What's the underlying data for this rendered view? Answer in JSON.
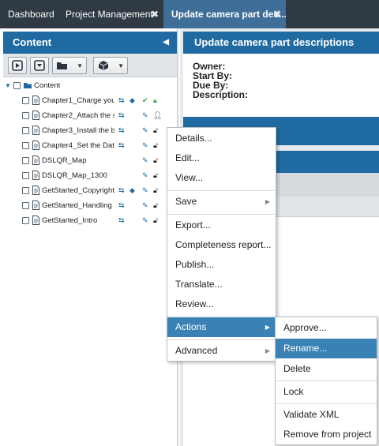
{
  "tabs": [
    {
      "label": "Dashboard"
    },
    {
      "label": "Project Management"
    },
    {
      "label": "Update camera part des..."
    }
  ],
  "left_panel": {
    "title": "Content",
    "toolbar": [
      {
        "icon": "play-icon"
      },
      {
        "icon": "download-icon"
      },
      {
        "icon": "folder-open-icon"
      },
      {
        "icon": "package-icon"
      }
    ],
    "root": {
      "label": "Content"
    },
    "items": [
      {
        "label": "Chapter1_Charge you...",
        "icons": [
          "sync-icon",
          "tags-icon",
          "check-circle-icon",
          "lock-icon"
        ]
      },
      {
        "label": "Chapter2_Attach the s...",
        "icons": [
          "sync-icon",
          "pencil-icon",
          "user-icon"
        ]
      },
      {
        "label": "Chapter3_Install the b...",
        "icons": [
          "sync-icon",
          "pencil-icon",
          "unlock-icon"
        ]
      },
      {
        "label": "Chapter4_Set the Dat...",
        "icons": [
          "sync-icon",
          "pencil-icon",
          "unlock-icon"
        ]
      },
      {
        "label": "DSLQR_Map",
        "icons": [
          "pencil-icon",
          "unlock-icon"
        ]
      },
      {
        "label": "DSLQR_Map_1300",
        "icons": [
          "pencil-icon",
          "unlock-icon"
        ]
      },
      {
        "label": "GetStarted_Copyrights",
        "icons": [
          "sync-icon",
          "tags-icon",
          "pencil-icon",
          "unlock-icon"
        ]
      },
      {
        "label": "GetStarted_Handling ...",
        "icons": [
          "sync-icon",
          "pencil-icon",
          "unlock-icon"
        ]
      },
      {
        "label": "GetStarted_Intro",
        "icons": [
          "sync-icon",
          "pencil-icon",
          "unlock-icon"
        ]
      }
    ]
  },
  "right_panel": {
    "title": "Update camera part descriptions",
    "fields": {
      "owner": "Owner:",
      "start_by": "Start By:",
      "due_by": "Due By:",
      "description": "Description:"
    }
  },
  "context_menu": {
    "items": [
      {
        "label": "Details..."
      },
      {
        "label": "Edit..."
      },
      {
        "label": "View..."
      },
      {
        "label": "Save"
      },
      {
        "label": "Export..."
      },
      {
        "label": "Completeness report..."
      },
      {
        "label": "Publish..."
      },
      {
        "label": "Translate..."
      },
      {
        "label": "Review..."
      },
      {
        "label": "Actions"
      },
      {
        "label": "Advanced"
      }
    ]
  },
  "actions_submenu": {
    "items": [
      {
        "label": "Approve..."
      },
      {
        "label": "Rename..."
      },
      {
        "label": "Delete"
      },
      {
        "label": "Lock"
      },
      {
        "label": "Validate XML"
      },
      {
        "label": "Remove from project"
      }
    ]
  },
  "colors": {
    "tabbar": "#2f3a44",
    "active_tab": "#3f6f99",
    "panel_header": "#1f6aa0",
    "menu_highlight": "#3a82b6"
  }
}
